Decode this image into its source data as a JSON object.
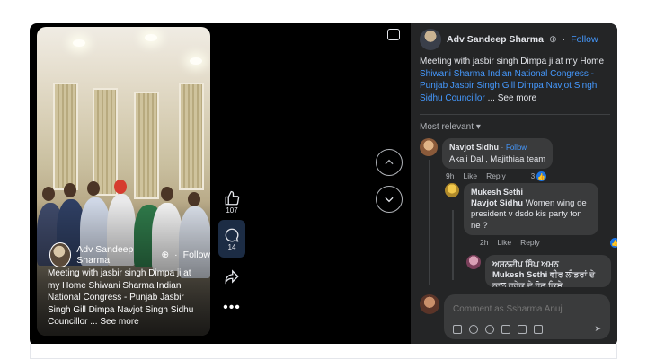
{
  "video": {
    "author": "Adv Sandeep Sharma",
    "follow_label": "Follow",
    "caption": "Meeting with jasbir singh Dimpa ji at my Home Shiwani Sharma Indian National Congress - Punjab Jasbir Singh Gill Dimpa Navjot Singh Sidhu Councillor ...",
    "see_more": "See more"
  },
  "actions": {
    "like_count": "107",
    "comment_count": "14"
  },
  "post": {
    "author": "Adv Sandeep Sharma",
    "follow_label": "Follow",
    "text": "Meeting with jasbir singh Dimpa ji at my Home",
    "links": "Shiwani Sharma Indian National Congress - Punjab Jasbir Singh Gill Dimpa Navjot Singh Sidhu  Councillor",
    "ellipsis": "...",
    "see_more": "See more"
  },
  "sort": {
    "label": "Most relevant"
  },
  "comments": [
    {
      "name": "Navjot Sidhu",
      "follow_label": "Follow",
      "text": "Akali Dal , Majithiaa team",
      "time": "9h",
      "like": "Like",
      "reply": "Reply",
      "reactions": "3"
    },
    {
      "name": "Mukesh Sethi",
      "tag": "Navjot Sidhu",
      "text": "Women wing de president v dsdo kis party ton ne ?",
      "time": "2h",
      "like": "Like",
      "reply": "Reply"
    },
    {
      "name": "ਅਸਨਦੀਪ ਸਿੰਘ ਅਮਨ",
      "tag": "Mukesh Sethi",
      "text": "ਵੀਰ ਲੀਡਰਾਂ ਦੇ ਨਾਲ ਹਰੇਕ ਦੇ ਹੋਣ ਕਿਸੇ"
    }
  ],
  "composer": {
    "placeholder": "Comment as Ssharma Anuj"
  },
  "colors": {
    "panel_bg": "#242526",
    "bubble_bg": "#3a3b3c",
    "link": "#4599ff",
    "like_blue": "#1b74e4"
  }
}
